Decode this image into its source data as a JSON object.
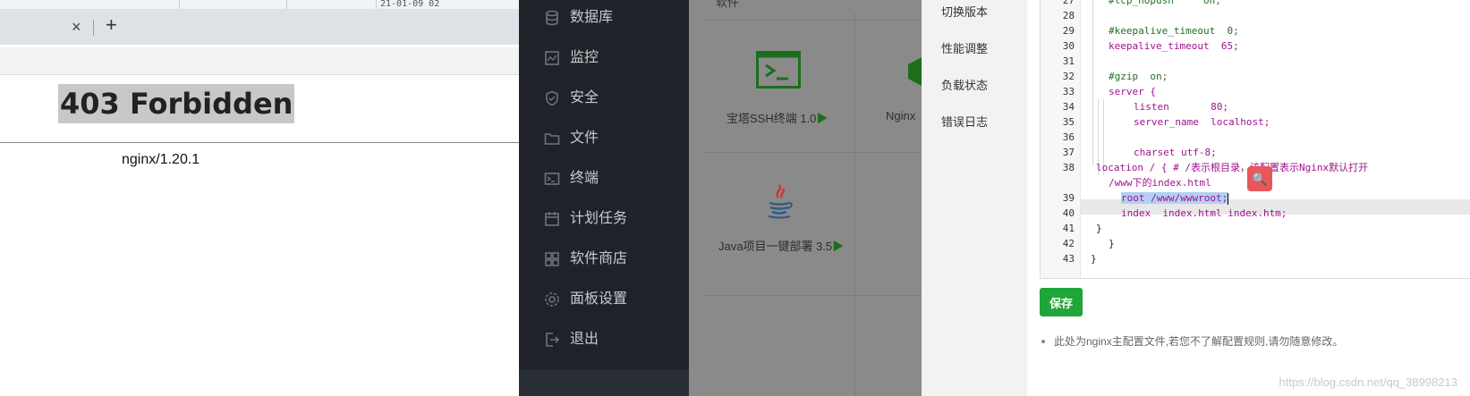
{
  "browser": {
    "top_peek_text": "21-01-09 02",
    "tab_close_glyph": "×",
    "new_tab_glyph": "+",
    "page_heading": "403 Forbidden",
    "server_line": "nginx/1.20.1"
  },
  "sidebar": {
    "items": [
      {
        "label": "数据库",
        "icon": "database-icon"
      },
      {
        "label": "监控",
        "icon": "monitor-icon"
      },
      {
        "label": "安全",
        "icon": "shield-icon"
      },
      {
        "label": "文件",
        "icon": "folder-icon"
      },
      {
        "label": "终端",
        "icon": "terminal-icon"
      },
      {
        "label": "计划任务",
        "icon": "calendar-icon"
      },
      {
        "label": "软件商店",
        "icon": "grid-icon"
      },
      {
        "label": "面板设置",
        "icon": "gear-icon"
      },
      {
        "label": "退出",
        "icon": "logout-icon"
      }
    ]
  },
  "store": {
    "header": "软件",
    "cards": [
      {
        "label": "宝塔SSH终端 1.0",
        "icon": "ssh-terminal-icon"
      },
      {
        "label": "Nginx",
        "icon": "nginx-icon"
      },
      {
        "label": "Java项目一键部署 3.5",
        "icon": "java-icon"
      }
    ],
    "play_glyph": "▶"
  },
  "modal": {
    "menu": [
      "切换版本",
      "性能调整",
      "负载状态",
      "错误日志"
    ],
    "editor": {
      "lines": [
        {
          "n": "27",
          "text": "#tcp_nopush     on;"
        },
        {
          "n": "28",
          "text": ""
        },
        {
          "n": "29",
          "text": "#keepalive_timeout  0;"
        },
        {
          "n": "30",
          "text": "keepalive_timeout  65;"
        },
        {
          "n": "31",
          "text": ""
        },
        {
          "n": "32",
          "text": "#gzip  on;"
        },
        {
          "n": "33",
          "text": "server {"
        },
        {
          "n": "34",
          "text": "listen       80;"
        },
        {
          "n": "35",
          "text": "server_name  localhost;"
        },
        {
          "n": "36",
          "text": ""
        },
        {
          "n": "37",
          "text": "charset utf-8;"
        },
        {
          "n": "38",
          "text": "location / { # /表示根目录，该配置表示Nginx默认打开"
        },
        {
          "n": "",
          "text": "/www下的index.html"
        },
        {
          "n": "39",
          "text": "root /www/wwwroot;"
        },
        {
          "n": "40",
          "text": "index  index.html index.htm;"
        },
        {
          "n": "41",
          "text": "}"
        },
        {
          "n": "42",
          "text": "}"
        },
        {
          "n": "43",
          "text": "}"
        }
      ]
    },
    "save_label": "保存",
    "note": "此处为nginx主配置文件,若您不了解配置规则,请勿随意修改。",
    "watermark": "https://blog.csdn.net/qq_38998213"
  }
}
